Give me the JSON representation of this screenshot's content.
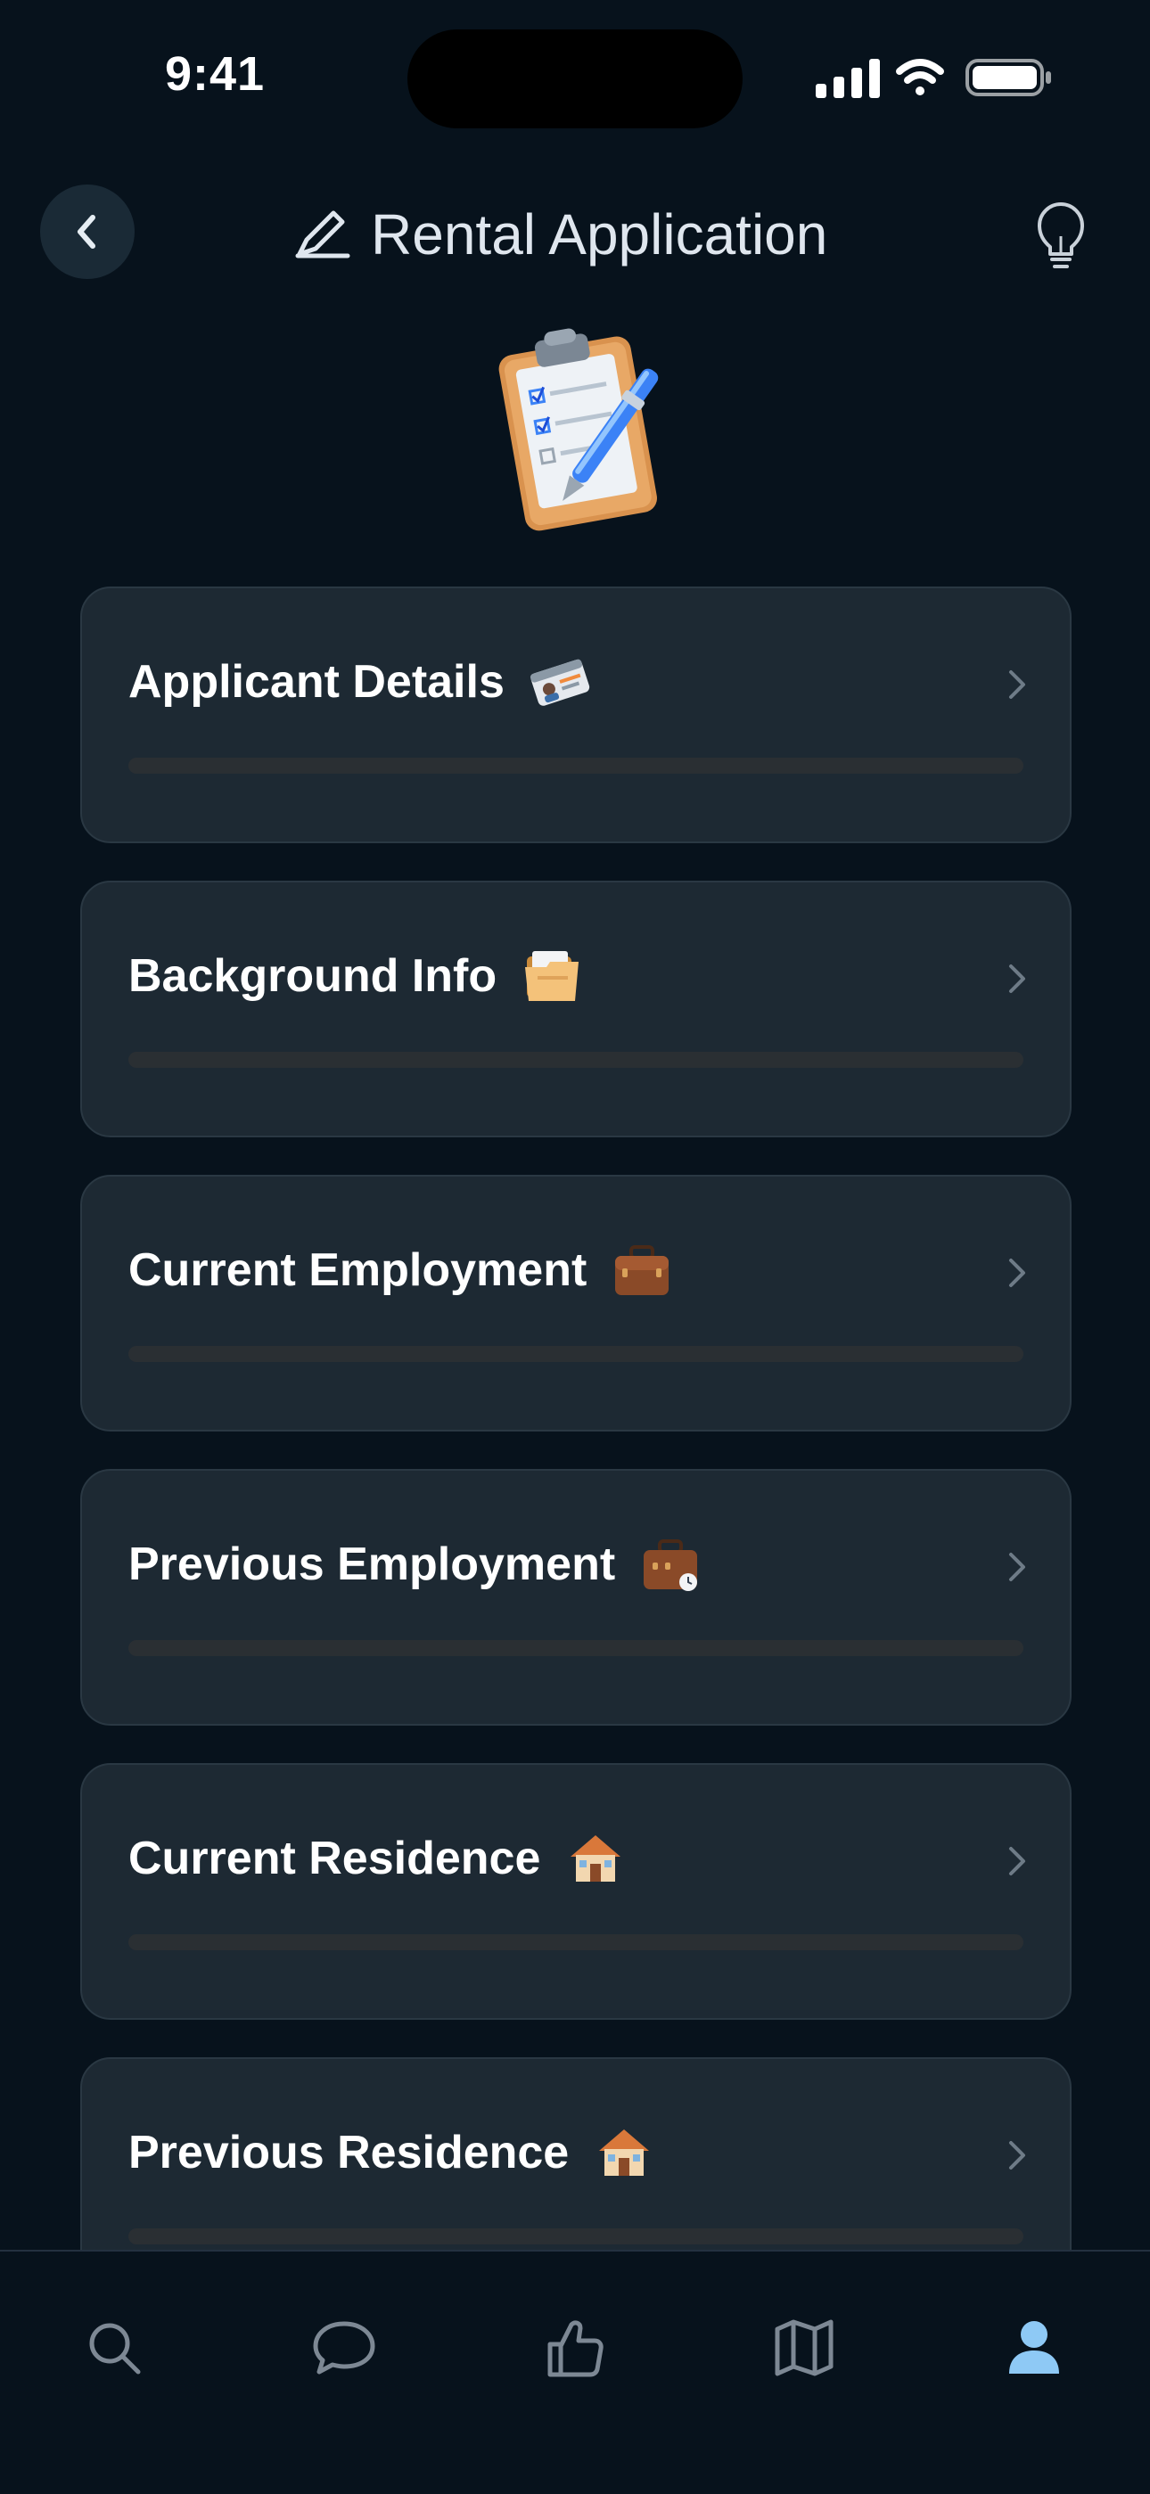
{
  "status_bar": {
    "time": "9:41"
  },
  "header": {
    "title": "Rental Application",
    "back_icon": "chevron-left-icon",
    "title_icon": "pencil-icon",
    "hint_icon": "lightbulb-icon"
  },
  "hero_icon": "clipboard-icon",
  "colors": {
    "background": "#07121c",
    "card": "#1d2933",
    "accent": "#4ba3e3"
  },
  "sections": [
    {
      "label": "Applicant Details",
      "icon": "id-card-icon",
      "progress": 0
    },
    {
      "label": "Background Info",
      "icon": "folder-icon",
      "progress": 0
    },
    {
      "label": "Current Employment",
      "icon": "briefcase-icon",
      "progress": 0
    },
    {
      "label": "Previous Employment",
      "icon": "briefcase-clock-icon",
      "progress": 0
    },
    {
      "label": "Current Residence",
      "icon": "house-icon",
      "progress": 0
    },
    {
      "label": "Previous Residence",
      "icon": "house-icon",
      "progress": 0
    }
  ],
  "tab_bar": {
    "tabs": [
      {
        "icon": "search-icon",
        "active": false
      },
      {
        "icon": "chat-bubble-icon",
        "active": false
      },
      {
        "icon": "thumbs-up-icon",
        "active": false
      },
      {
        "icon": "map-icon",
        "active": false
      },
      {
        "icon": "person-icon",
        "active": true
      }
    ]
  }
}
